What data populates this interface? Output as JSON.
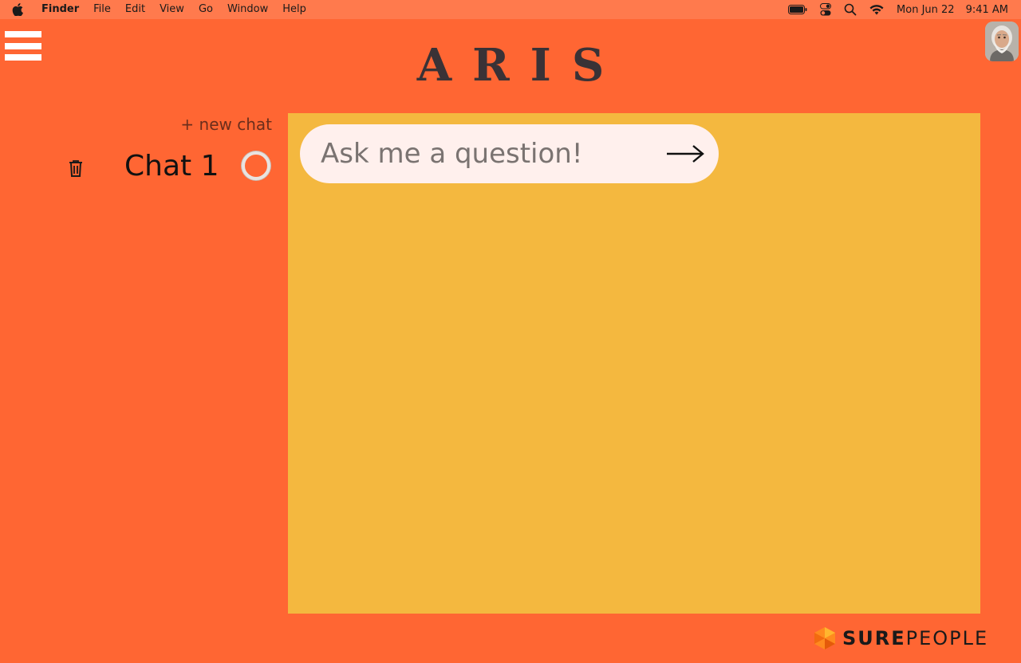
{
  "menubar": {
    "app_name": "Finder",
    "menus": [
      "File",
      "Edit",
      "View",
      "Go",
      "Window",
      "Help"
    ],
    "date": "Mon Jun 22",
    "time": "9:41 AM"
  },
  "logo": "ARIS",
  "sidebar": {
    "new_chat_label": "+ new chat",
    "chats": [
      {
        "title": "Chat 1"
      }
    ]
  },
  "chat": {
    "input_placeholder": "Ask me a question!"
  },
  "footer": {
    "brand_bold": "SURE",
    "brand_regular": "PEOPLE"
  },
  "colors": {
    "background": "#ff6633",
    "panel": "#f4b83f",
    "input": "#fff0ed"
  }
}
